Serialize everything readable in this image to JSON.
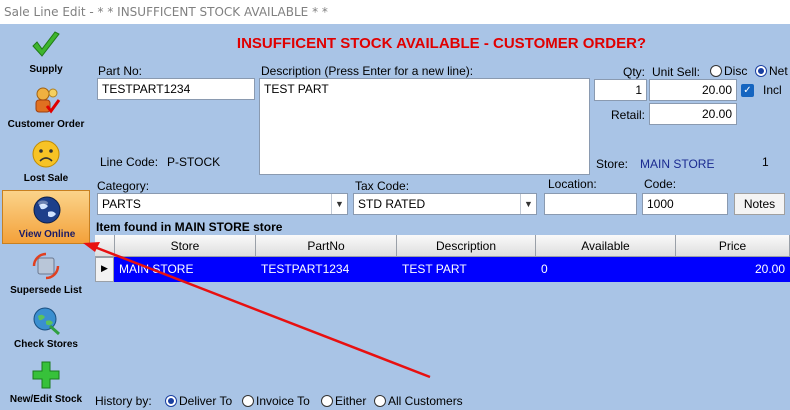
{
  "window": {
    "title": "Sale Line Edit - * * INSUFFICENT STOCK AVAILABLE * *"
  },
  "sidebar": {
    "items": [
      {
        "label": "Supply",
        "icon": "check-icon"
      },
      {
        "label": "Customer Order",
        "icon": "customer-order-icon"
      },
      {
        "label": "Lost Sale",
        "icon": "sad-face-icon"
      },
      {
        "label": "View Online",
        "icon": "globe-icon"
      },
      {
        "label": "Supersede List",
        "icon": "supersede-icon"
      },
      {
        "label": "Check Stores",
        "icon": "check-stores-icon"
      },
      {
        "label": "New/Edit Stock",
        "icon": "plus-icon"
      }
    ]
  },
  "header": {
    "headline": "INSUFFICENT STOCK AVAILABLE - CUSTOMER ORDER?"
  },
  "form": {
    "part_no_label": "Part No:",
    "part_no_value": "TESTPART1234",
    "description_label": "Description (Press Enter for a new line):",
    "description_value": "TEST PART",
    "qty_label": "Qty:",
    "qty_value": "1",
    "unit_sell_label": "Unit Sell:",
    "disc_label": "Disc",
    "net_label": "Net",
    "unit_sell_value": "20.00",
    "incl_label": "Incl",
    "retail_label": "Retail:",
    "retail_value": "20.00",
    "line_code_label": "Line Code:",
    "line_code_value": "P-STOCK",
    "store_label": "Store:",
    "store_value": "MAIN STORE",
    "store_count": "1",
    "category_label": "Category:",
    "category_value": "PARTS",
    "tax_code_label": "Tax Code:",
    "tax_code_value": "STD RATED",
    "location_label": "Location:",
    "location_value": "",
    "code_label": "Code:",
    "code_value": "1000",
    "notes_label": "Notes"
  },
  "found_text": "Item found in MAIN STORE store",
  "table": {
    "columns": [
      "Store",
      "PartNo",
      "Description",
      "Available",
      "Price"
    ],
    "rows": [
      {
        "store": "MAIN STORE",
        "partno": "TESTPART1234",
        "description": "TEST PART",
        "available": "0",
        "price": "20.00"
      }
    ]
  },
  "history": {
    "label": "History by:",
    "options": [
      "Deliver To",
      "Invoice To",
      "Either",
      "All Customers"
    ],
    "selected": "Deliver To"
  },
  "colors": {
    "panel": "#a9c4e6",
    "headline": "#e00000",
    "selection": "#0000ff",
    "annotation": "#e81010"
  }
}
